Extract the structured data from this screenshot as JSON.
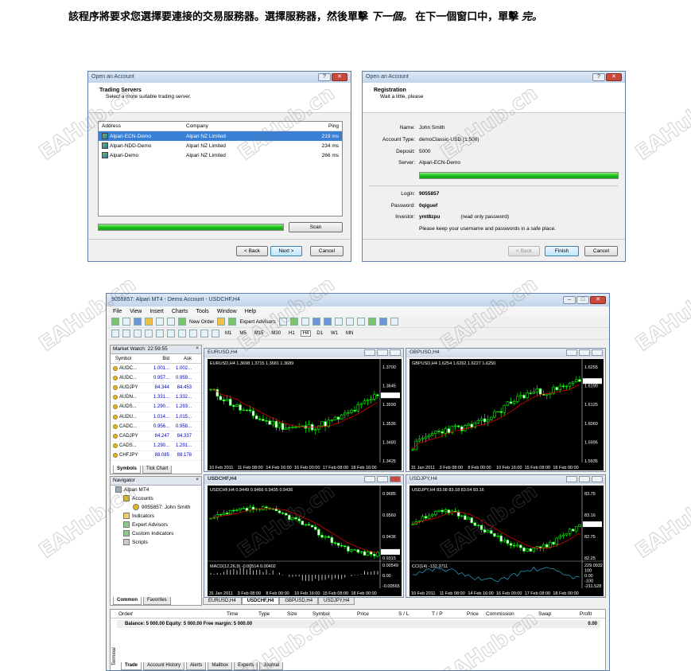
{
  "caption": {
    "pre": "該程序將要求您選擇要連接的交易服務器。選擇服務器，然後單擊",
    "next": "下一個。",
    "mid": "在下一個窗口中，單擊",
    "finish": "完。"
  },
  "dialog1": {
    "title": "Open an Account",
    "heading": "Trading Servers",
    "sub": "Select a more suitable trading server.",
    "columns": [
      "Address",
      "Company",
      "Ping"
    ],
    "rows": [
      [
        "Alpari-ECN-Demo",
        "Alpari NZ Limited",
        "219 ms"
      ],
      [
        "Alpari-NDD-Demo",
        "Alpari NZ Limited",
        "234 ms"
      ],
      [
        "Alpari-Demo",
        "Alpari NZ Limited",
        "266 ms"
      ]
    ],
    "scan": "Scan",
    "back": "< Back",
    "next": "Next >",
    "cancel": "Cancel"
  },
  "dialog2": {
    "title": "Open an Account",
    "heading": "Registration",
    "sub": "Wait a little, please",
    "name_l": "Name:",
    "name": "John Smith",
    "type_l": "Account Type:",
    "type": "demoClassic-USD (1:500)",
    "deposit_l": "Deposit:",
    "deposit": "5000",
    "server_l": "Server:",
    "server": "Alpari-ECN-Demo",
    "login_l": "Login:",
    "login": "9055857",
    "pass_l": "Password:",
    "pass": "0qiguef",
    "inv_l": "Investor:",
    "inv": "ymt8zpu",
    "inv_note": "(read only password)",
    "note": "Please keep your username and passwords in a safe place.",
    "back": "< Back",
    "finish": "Finish",
    "cancel": "Cancel"
  },
  "mt4": {
    "title": "9055857: Alpari MT4 - Demo Account - USDCHF,H4",
    "menu": [
      "File",
      "View",
      "Insert",
      "Charts",
      "Tools",
      "Window",
      "Help"
    ],
    "new_order": "New Order",
    "expert": "Expert Advisors",
    "timeframes": [
      "M1",
      "M5",
      "M15",
      "M30",
      "H1",
      "H4",
      "D1",
      "W1",
      "MN"
    ],
    "mw_title": "Market Watch: 22:59:55",
    "mw_cols": [
      "Symbol",
      "Bid",
      "Ask"
    ],
    "mw_rows": [
      [
        "AUDC...",
        "1.001...",
        "1.002..."
      ],
      [
        "AUDC...",
        "0.957...",
        "0.959..."
      ],
      [
        "AUDJPY",
        "84.344",
        "84.453"
      ],
      [
        "AUDN...",
        "1.331...",
        "1.332..."
      ],
      [
        "AUDS...",
        "1.290...",
        "1.293..."
      ],
      [
        "AUDU...",
        "1.014...",
        "1.015..."
      ],
      [
        "CADC...",
        "0.956...",
        "0.958..."
      ],
      [
        "CADJPY",
        "84.247",
        "84.337"
      ],
      [
        "CADS...",
        "1.290...",
        "1.291..."
      ],
      [
        "CHFJPY",
        "88.085",
        "88.178"
      ]
    ],
    "mw_tabs": [
      "Symbols",
      "Tick Chart"
    ],
    "nav_title": "Navigator",
    "nav": [
      "Alpari MT4",
      "Accounts",
      "9055857: John Smith",
      "Indicators",
      "Expert Advisors",
      "Custom Indicators",
      "Scripts"
    ],
    "nav_tabs": [
      "Common",
      "Favorites"
    ],
    "chart_tabs": [
      "EURUSD,H4",
      "USDCHF,H4",
      "GBPUSD,H4",
      "USDJPY,H4"
    ],
    "term_cols": [
      "Order",
      "/",
      "Time",
      "Type",
      "Size",
      "Symbol",
      "Price",
      "S / L",
      "T / P",
      "Price",
      "Commission",
      "Swap",
      "Profit"
    ],
    "balance": "Balance: 5 000.00  Equity: 5 000.00  Free margin: 5 000.00",
    "profit": "0.00",
    "term_tabs": [
      "Trade",
      "Account History",
      "Alerts",
      "Mailbox",
      "Experts",
      "Journal"
    ],
    "terminal": "Terminal"
  },
  "charts": [
    {
      "win": "EURUSD,H4",
      "info": "EURUSD,H4  1.3698 1.3715 1.3681 1.3689",
      "prices": [
        "1.3700",
        "1.3645",
        "1.3590",
        "1.3535",
        "1.3480",
        "1.3425"
      ],
      "last": "1.3689",
      "dates": [
        "10 Feb 2011",
        "11 Feb 08:00",
        "14 Feb 16:00",
        "16 Feb 00:00",
        "17 Feb 08:00",
        "18 Feb 16:00"
      ]
    },
    {
      "win": "GBPUSD,H4",
      "info": "GBPUSD,H4  1.6254 1.6262 1.6227 1.6250",
      "prices": [
        "1.6255",
        "1.6190",
        "1.6125",
        "1.6060",
        "1.5995",
        "1.5935"
      ],
      "last": "1.6250",
      "dates": [
        "31 Jan 2011",
        "3 Feb 08:00",
        "8 Feb 00:00",
        "10 Feb 16:00",
        "15 Feb 08:00",
        "18 Feb 00:00"
      ]
    },
    {
      "win": "USDCHF,H4",
      "info": "USDCHF,H4  0.9449 0.9466 0.9435 0.9436",
      "prices": [
        "0.9685",
        "0.9560",
        "0.9436",
        "0.9315"
      ],
      "last": "0.9436",
      "macd": "MACD(12,26,9)  -0.00514  0.00402",
      "macd_vals": [
        "0.00549",
        "0.00",
        "-0.00565"
      ],
      "dates": [
        "31 Jan 2011",
        "3 Feb 08:00",
        "8 Feb 00:00",
        "10 Feb 16:00",
        "15 Feb 08:00",
        "18 Feb 00:00"
      ]
    },
    {
      "win": "USDJPY,H4",
      "info": "USDJPY,H4  83.08 83.18 83.04 83.16",
      "prices": [
        "83.75",
        "83.16",
        "82.75",
        "82.25"
      ],
      "last": "83.16",
      "cci": "CCI(14)  -132.3711",
      "cci_vals": [
        "229.0932",
        "100",
        "0.00",
        "-100",
        "-211.528"
      ],
      "dates": [
        "10 Feb 2011",
        "11 Feb 08:00",
        "14 Feb 16:00",
        "16 Feb 00:00",
        "17 Feb 08:00",
        "18 Feb 00:00"
      ]
    }
  ],
  "watermark": "EAHub.cn"
}
